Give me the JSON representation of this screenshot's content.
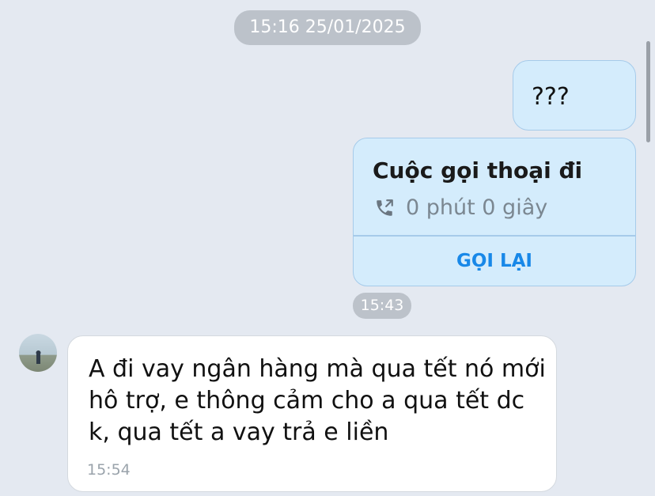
{
  "conversation": {
    "date_separator": "15:16 25/01/2025",
    "messages": [
      {
        "direction": "outgoing",
        "type": "text",
        "text": "???"
      },
      {
        "direction": "outgoing",
        "type": "call",
        "title": "Cuộc gọi thoại đi",
        "duration": "0 phút 0 giây",
        "action_label": "GỌI LẠI",
        "icon": "phone-outgoing-icon"
      },
      {
        "type": "time_separator",
        "time": "15:43"
      },
      {
        "direction": "incoming",
        "type": "text",
        "avatar": "avatar",
        "text": "A đi vay ngân hàng mà qua tết nó mới hô trợ, e thông cảm cho a qua tết dc k, qua tết a vay trả e liền",
        "time": "15:54"
      }
    ]
  },
  "colors": {
    "background": "#e4e9f1",
    "outgoing_bubble": "#d4ecfc",
    "incoming_bubble": "#ffffff",
    "accent": "#1888e8",
    "separator_pill": "#bcc2ca"
  }
}
